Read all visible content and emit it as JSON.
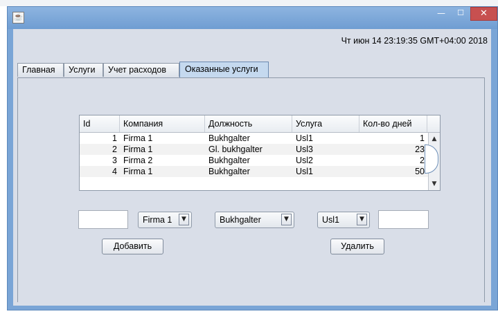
{
  "window": {
    "title": "",
    "app_icon": "java-icon",
    "minimize_icon": "minimize-icon",
    "maximize_icon": "maximize-icon",
    "close_icon": "close-icon",
    "close_color": "#c75050"
  },
  "datetime": "Чт июн 14 23:19:35 GMT+04:00 2018",
  "tabs": [
    {
      "label": "Главная",
      "active": false
    },
    {
      "label": "Услуги",
      "active": false
    },
    {
      "label": "Учет расходов",
      "active": false
    },
    {
      "label": "Оказанные услуги",
      "active": true
    }
  ],
  "table": {
    "columns": [
      "Id",
      "Компания",
      "Должность",
      "Услуга",
      "Кол-во дней"
    ],
    "rows": [
      {
        "id": "1",
        "company": "Firma 1",
        "position": "Bukhgalter",
        "service": "Usl1",
        "days": "1"
      },
      {
        "id": "2",
        "company": "Firma 1",
        "position": "Gl. bukhgalter",
        "service": "Usl3",
        "days": "23"
      },
      {
        "id": "3",
        "company": "Firma 2",
        "position": "Bukhgalter",
        "service": "Usl2",
        "days": "2"
      },
      {
        "id": "4",
        "company": "Firma 1",
        "position": "Bukhgalter",
        "service": "Usl1",
        "days": "50"
      }
    ]
  },
  "form": {
    "id_value": "",
    "company_selected": "Firma 1",
    "position_selected": "Bukhgalter",
    "service_selected": "Usl1",
    "days_value": "",
    "add_label": "Добавить",
    "delete_label": "Удалить"
  }
}
